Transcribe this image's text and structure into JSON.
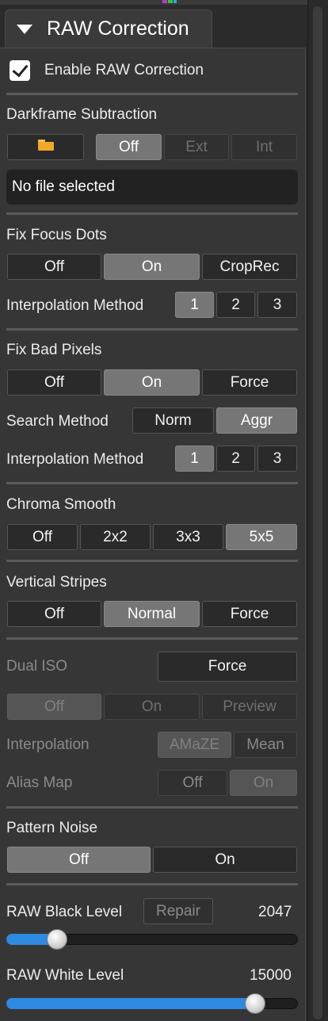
{
  "tab": {
    "title": "RAW Correction"
  },
  "enable": {
    "label": "Enable RAW Correction",
    "checked": true
  },
  "darkframe": {
    "title": "Darkframe Subtraction",
    "buttons": [
      "Off",
      "Ext",
      "Int"
    ],
    "file_status": "No file selected"
  },
  "focus_dots": {
    "title": "Fix Focus Dots",
    "buttons": [
      "Off",
      "On",
      "CropRec"
    ],
    "interp_label": "Interpolation Method",
    "interp_buttons": [
      "1",
      "2",
      "3"
    ]
  },
  "bad_pixels": {
    "title": "Fix Bad Pixels",
    "buttons": [
      "Off",
      "On",
      "Force"
    ],
    "search_label": "Search Method",
    "search_buttons": [
      "Norm",
      "Aggr"
    ],
    "interp_label": "Interpolation Method",
    "interp_buttons": [
      "1",
      "2",
      "3"
    ]
  },
  "chroma": {
    "title": "Chroma Smooth",
    "buttons": [
      "Off",
      "2x2",
      "3x3",
      "5x5"
    ]
  },
  "stripes": {
    "title": "Vertical Stripes",
    "buttons": [
      "Off",
      "Normal",
      "Force"
    ]
  },
  "dual_iso": {
    "title": "Dual ISO",
    "force": "Force",
    "buttons": [
      "Off",
      "On",
      "Preview"
    ],
    "interp_label": "Interpolation",
    "interp_buttons": [
      "AMaZE",
      "Mean"
    ],
    "alias_label": "Alias Map",
    "alias_buttons": [
      "Off",
      "On"
    ]
  },
  "pattern": {
    "title": "Pattern Noise",
    "buttons": [
      "Off",
      "On"
    ]
  },
  "black": {
    "label": "RAW Black Level",
    "repair": "Repair",
    "value": "2047",
    "fraction": 0.15
  },
  "white": {
    "label": "RAW White Level",
    "value": "15000",
    "fraction": 0.88
  },
  "colors": {
    "accent": "#2d8ae0",
    "selected": "#767676",
    "panel": "#363636",
    "folder": "#f0a92a"
  },
  "icons": {
    "tab": "triangle-down-icon",
    "file": "folder-icon",
    "check": "checkmark-icon"
  }
}
